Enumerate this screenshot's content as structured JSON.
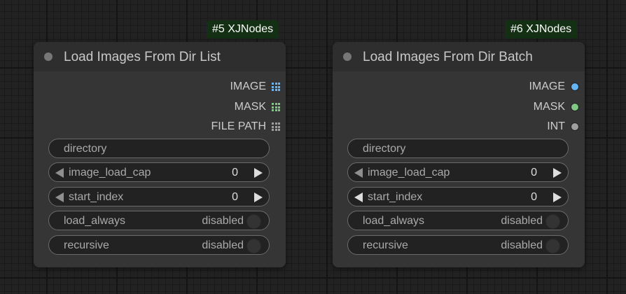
{
  "nodes": [
    {
      "badge": "#5 XJNodes",
      "title": "Load Images From Dir List",
      "outputs": [
        {
          "label": "IMAGE",
          "icon": "grid-icon",
          "color": "#64b5f6"
        },
        {
          "label": "MASK",
          "icon": "grid-icon",
          "color": "#81c784"
        },
        {
          "label": "FILE PATH",
          "icon": "grid-icon",
          "color": "#9e9e9e"
        }
      ],
      "widgets": {
        "directory": "directory",
        "image_load_cap": {
          "label": "image_load_cap",
          "value": "0"
        },
        "start_index": {
          "label": "start_index",
          "value": "0"
        },
        "load_always": {
          "label": "load_always",
          "value": "disabled"
        },
        "recursive": {
          "label": "recursive",
          "value": "disabled"
        }
      }
    },
    {
      "badge": "#6 XJNodes",
      "title": "Load Images From Dir Batch",
      "outputs": [
        {
          "label": "IMAGE",
          "icon": "dot-icon",
          "color": "#64b5f6"
        },
        {
          "label": "MASK",
          "icon": "dot-icon",
          "color": "#81c784"
        },
        {
          "label": "INT",
          "icon": "dot-icon",
          "color": "#9e9e9e"
        }
      ],
      "widgets": {
        "directory": "directory",
        "image_load_cap": {
          "label": "image_load_cap",
          "value": "0"
        },
        "start_index": {
          "label": "start_index",
          "value": "0"
        },
        "load_always": {
          "label": "load_always",
          "value": "disabled"
        },
        "recursive": {
          "label": "recursive",
          "value": "disabled"
        }
      }
    }
  ]
}
